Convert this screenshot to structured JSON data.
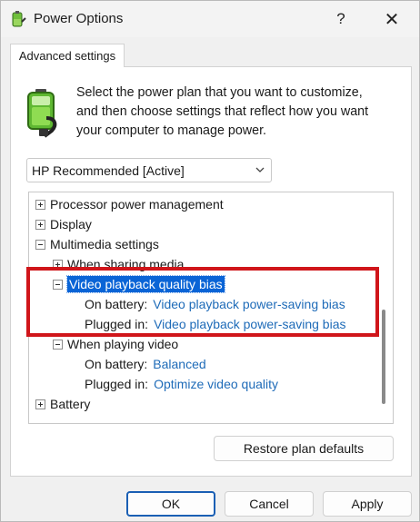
{
  "window": {
    "title": "Power Options",
    "help_glyph": "?",
    "close_glyph": "✕"
  },
  "tab": {
    "label": "Advanced settings"
  },
  "description": "Select the power plan that you want to customize, and then choose settings that reflect how you want your computer to manage power.",
  "plan_select": {
    "value": "HP Recommended [Active]"
  },
  "tree": {
    "processor": "Processor power management",
    "display": "Display",
    "multimedia": "Multimedia settings",
    "when_sharing": "When sharing media",
    "video_bias": "Video playback quality bias",
    "bias_battery_label": "On battery:",
    "bias_battery_value": "Video playback power-saving bias",
    "bias_plugged_label": "Plugged in:",
    "bias_plugged_value": "Video playback power-saving bias",
    "when_playing": "When playing video",
    "playing_battery_label": "On battery:",
    "playing_battery_value": "Balanced",
    "playing_plugged_label": "Plugged in:",
    "playing_plugged_value": "Optimize video quality",
    "battery": "Battery"
  },
  "buttons": {
    "restore": "Restore plan defaults",
    "ok": "OK",
    "cancel": "Cancel",
    "apply": "Apply"
  },
  "colors": {
    "link": "#1e6bb8",
    "selection": "#0a64d6",
    "highlight_box": "#d0151a"
  },
  "icons": {
    "app": "power-options-battery-icon",
    "plan": "battery-plug-icon"
  }
}
